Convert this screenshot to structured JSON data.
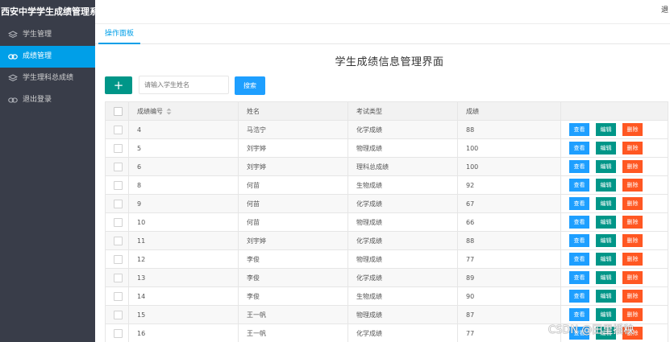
{
  "brand": {
    "title": "西安中学学生成绩管理系"
  },
  "header": {
    "logout_text": "退"
  },
  "sidebar": {
    "items": [
      {
        "label": "学生管理",
        "icon": "layers-icon",
        "active": false
      },
      {
        "label": "成绩管理",
        "icon": "link-icon",
        "active": true
      },
      {
        "label": "学生理科总成绩",
        "icon": "layers-icon",
        "active": false
      },
      {
        "label": "退出登录",
        "icon": "link-icon",
        "active": false
      }
    ]
  },
  "tabs": {
    "ops_label": "操作面板"
  },
  "page": {
    "title": "学生成绩信息管理界面"
  },
  "toolbar": {
    "add_label": "+",
    "search_placeholder": "请输入学生姓名",
    "search_label": "搜索"
  },
  "table": {
    "headers": {
      "id": "成绩编号",
      "name": "姓名",
      "type": "考试类型",
      "score": "成绩"
    },
    "rows": [
      {
        "id": "4",
        "name": "马浩宁",
        "type": "化学成绩",
        "score": "88"
      },
      {
        "id": "5",
        "name": "刘宇婷",
        "type": "物理成绩",
        "score": "100"
      },
      {
        "id": "6",
        "name": "刘宇婷",
        "type": "理科总成绩",
        "score": "100"
      },
      {
        "id": "8",
        "name": "何苗",
        "type": "生物成绩",
        "score": "92"
      },
      {
        "id": "9",
        "name": "何苗",
        "type": "化学成绩",
        "score": "67"
      },
      {
        "id": "10",
        "name": "何苗",
        "type": "物理成绩",
        "score": "66"
      },
      {
        "id": "11",
        "name": "刘宇婷",
        "type": "化学成绩",
        "score": "88"
      },
      {
        "id": "12",
        "name": "李俊",
        "type": "物理成绩",
        "score": "77"
      },
      {
        "id": "13",
        "name": "李俊",
        "type": "化学成绩",
        "score": "89"
      },
      {
        "id": "14",
        "name": "李俊",
        "type": "生物成绩",
        "score": "90"
      },
      {
        "id": "15",
        "name": "王一帆",
        "type": "物理成绩",
        "score": "87"
      },
      {
        "id": "16",
        "name": "王一帆",
        "type": "化学成绩",
        "score": "77"
      }
    ],
    "actions": {
      "view": "查看",
      "edit": "编辑",
      "delete": "删除"
    }
  },
  "watermark": {
    "text": "CSDN @田里插秧"
  },
  "colors": {
    "sidebar_bg": "#393d49",
    "active_blue": "#009fe8",
    "teal": "#009688",
    "view_blue": "#1e9fff",
    "delete_orange": "#ff5722"
  }
}
